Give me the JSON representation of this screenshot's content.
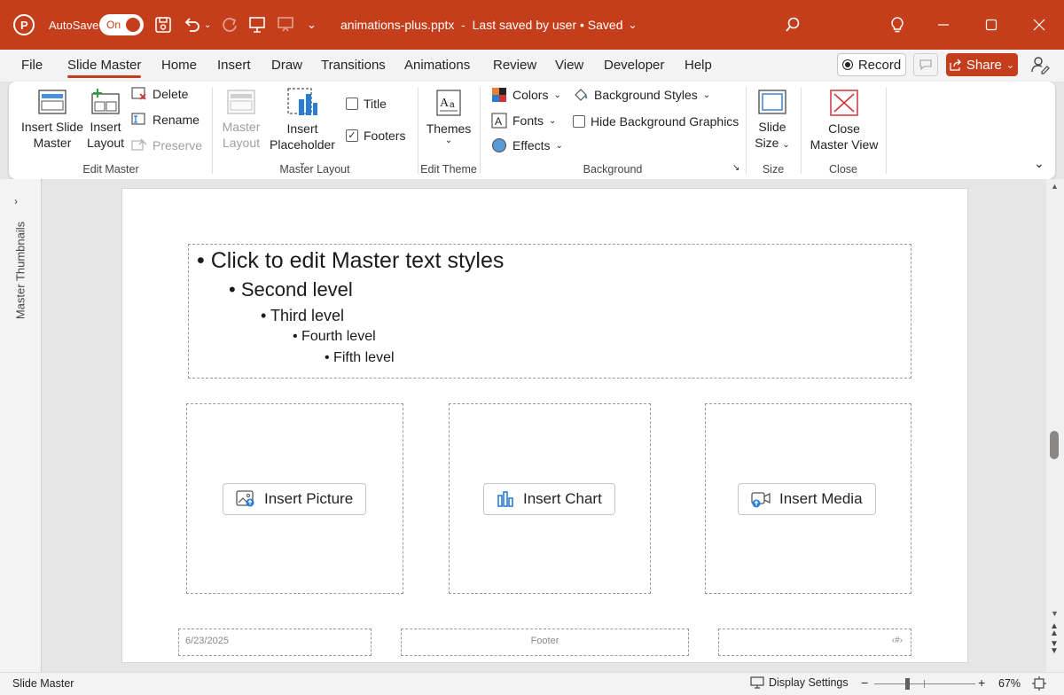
{
  "titlebar": {
    "autosave_label": "AutoSave",
    "autosave_state": "On",
    "file_title": "animations-plus.pptx  -  Last saved by user • Saved"
  },
  "menu": {
    "tabs": [
      "File",
      "Slide Master",
      "Home",
      "Insert",
      "Draw",
      "Transitions",
      "Animations",
      "Review",
      "View",
      "Developer",
      "Help"
    ],
    "active_tab": "Slide Master",
    "record_label": "Record",
    "share_label": "Share"
  },
  "ribbon": {
    "insert_slide_master": [
      "Insert Slide",
      "Master"
    ],
    "insert_layout": [
      "Insert",
      "Layout"
    ],
    "delete_label": "Delete",
    "rename_label": "Rename",
    "preserve_label": "Preserve",
    "edit_master_group": "Edit Master",
    "master_layout_btn": [
      "Master",
      "Layout"
    ],
    "insert_placeholder": [
      "Insert",
      "Placeholder"
    ],
    "title_cb": {
      "label": "Title",
      "checked": false
    },
    "footers_cb": {
      "label": "Footers",
      "checked": true
    },
    "master_layout_group": "Master Layout",
    "themes_label": "Themes",
    "edit_theme_group": "Edit Theme",
    "colors_label": "Colors",
    "fonts_label": "Fonts",
    "effects_label": "Effects",
    "background_styles_label": "Background Styles",
    "hide_bg_label": "Hide Background Graphics",
    "background_group": "Background",
    "slide_size": [
      "Slide",
      "Size"
    ],
    "size_group": "Size",
    "close_master_view": [
      "Close",
      "Master View"
    ],
    "close_group": "Close"
  },
  "sidepanel": {
    "label": "Master Thumbnails"
  },
  "slide": {
    "levels": [
      "Click to edit Master text styles",
      "Second level",
      "Third level",
      "Fourth level",
      "Fifth level"
    ],
    "insert_picture": "Insert Picture",
    "insert_chart": "Insert Chart",
    "insert_media": "Insert Media",
    "date": "6/23/2025",
    "footer": "Footer",
    "slide_number": "‹#›"
  },
  "status": {
    "view_name": "Slide Master",
    "display_settings": "Display Settings",
    "zoom": "67%"
  },
  "colors": {
    "accent": "#c43e1c",
    "chart_icon": "#2b7cd3"
  }
}
